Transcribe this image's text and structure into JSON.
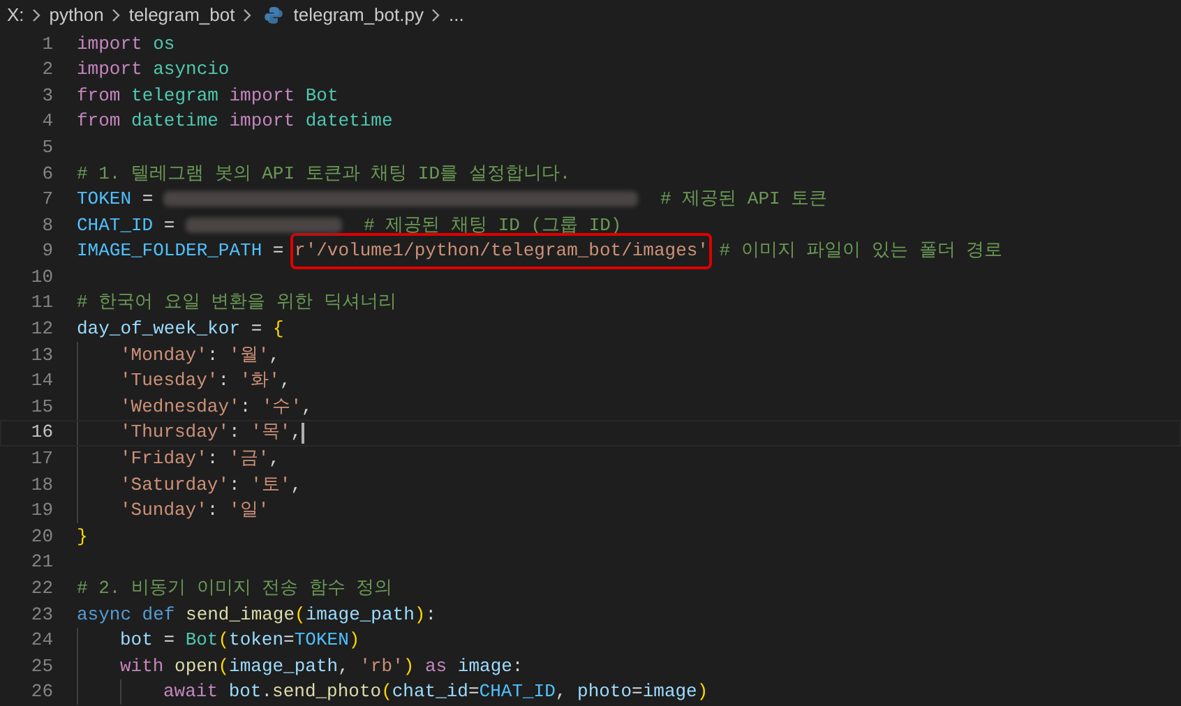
{
  "breadcrumb": [
    {
      "kind": "folder",
      "text": "X:"
    },
    {
      "kind": "folder",
      "text": "python"
    },
    {
      "kind": "folder",
      "text": "telegram_bot"
    },
    {
      "kind": "file",
      "text": "telegram_bot.py"
    },
    {
      "kind": "more",
      "text": "..."
    }
  ],
  "lines": [
    {
      "number": "1",
      "current": false,
      "tokens": [
        {
          "kind": "keyword",
          "text": "import"
        },
        {
          "kind": "type",
          "text": " os"
        }
      ]
    },
    {
      "number": "2",
      "current": false,
      "tokens": [
        {
          "kind": "keyword",
          "text": "import"
        },
        {
          "kind": "type",
          "text": " asyncio"
        }
      ]
    },
    {
      "number": "3",
      "current": false,
      "tokens": [
        {
          "kind": "keyword",
          "text": "from"
        },
        {
          "kind": "type",
          "text": " telegram"
        },
        {
          "kind": "keyword",
          "text": " import"
        },
        {
          "kind": "type",
          "text": " Bot"
        }
      ]
    },
    {
      "number": "4",
      "current": false,
      "tokens": [
        {
          "kind": "keyword",
          "text": "from"
        },
        {
          "kind": "type",
          "text": " datetime"
        },
        {
          "kind": "keyword",
          "text": " import"
        },
        {
          "kind": "type",
          "text": " datetime"
        }
      ]
    },
    {
      "number": "5",
      "current": false
    },
    {
      "number": "6",
      "current": false,
      "tokens": [
        {
          "kind": "comment",
          "text": "# 1. 텔레그램 봇의 API 토큰과 채팅 ID를 설정합니다."
        }
      ]
    },
    {
      "number": "7",
      "current": false,
      "tokens": [
        {
          "kind": "constant",
          "text": "TOKEN"
        },
        {
          "kind": "plain",
          "text": " = "
        },
        {
          "kind": "redacted"
        },
        {
          "kind": "comment",
          "text": "  # 제공된 API 토큰"
        }
      ]
    },
    {
      "number": "8",
      "current": false,
      "tokens": [
        {
          "kind": "constant",
          "text": "CHAT_ID"
        },
        {
          "kind": "plain",
          "text": " = "
        },
        {
          "kind": "redacted_short"
        },
        {
          "kind": "comment",
          "text": "  # 제공된 채팅 ID (그룹 ID)"
        }
      ]
    },
    {
      "number": "9",
      "current": false,
      "tokens": [
        {
          "kind": "constant",
          "text": "IMAGE_FOLDER_PATH"
        },
        {
          "kind": "plain",
          "text": " = "
        },
        {
          "kind": "string",
          "text": "r'/volume1/python/telegram_bot/images'",
          "highlighted": true
        },
        {
          "kind": "comment",
          "text": " # 이미지 파일이 있는 폴더 경로"
        }
      ]
    },
    {
      "number": "10",
      "current": false
    },
    {
      "number": "11",
      "current": false,
      "tokens": [
        {
          "kind": "comment",
          "text": "# 한국어 요일 변환을 위한 딕셔너리"
        }
      ]
    },
    {
      "number": "12",
      "current": false,
      "tokens": [
        {
          "kind": "variable",
          "text": "day_of_week_kor"
        },
        {
          "kind": "plain",
          "text": " = "
        },
        {
          "kind": "bracket",
          "text": "{"
        }
      ],
      "children": [
        {
          "number": "13",
          "current": false,
          "tokens": [
            {
              "kind": "string",
              "text": "'Monday'"
            },
            {
              "kind": "plain",
              "text": ": "
            },
            {
              "kind": "string",
              "text": "'월'"
            },
            {
              "kind": "plain",
              "text": ","
            }
          ]
        },
        {
          "number": "14",
          "current": false,
          "tokens": [
            {
              "kind": "string",
              "text": "'Tuesday'"
            },
            {
              "kind": "plain",
              "text": ": "
            },
            {
              "kind": "string",
              "text": "'화'"
            },
            {
              "kind": "plain",
              "text": ","
            }
          ]
        },
        {
          "number": "15",
          "current": false,
          "tokens": [
            {
              "kind": "string",
              "text": "'Wednesday'"
            },
            {
              "kind": "plain",
              "text": ": "
            },
            {
              "kind": "string",
              "text": "'수'"
            },
            {
              "kind": "plain",
              "text": ","
            }
          ]
        },
        {
          "number": "16",
          "current": true,
          "tokens": [
            {
              "kind": "string",
              "text": "'Thursday'"
            },
            {
              "kind": "plain",
              "text": ": "
            },
            {
              "kind": "string",
              "text": "'목'"
            },
            {
              "kind": "plain",
              "text": ","
            }
          ]
        },
        {
          "number": "17",
          "current": false,
          "tokens": [
            {
              "kind": "string",
              "text": "'Friday'"
            },
            {
              "kind": "plain",
              "text": ": "
            },
            {
              "kind": "string",
              "text": "'금'"
            },
            {
              "kind": "plain",
              "text": ","
            }
          ]
        },
        {
          "number": "18",
          "current": false,
          "tokens": [
            {
              "kind": "string",
              "text": "'Saturday'"
            },
            {
              "kind": "plain",
              "text": ": "
            },
            {
              "kind": "string",
              "text": "'토'"
            },
            {
              "kind": "plain",
              "text": ","
            }
          ]
        },
        {
          "number": "19",
          "current": false,
          "tokens": [
            {
              "kind": "string",
              "text": "'Sunday'"
            },
            {
              "kind": "plain",
              "text": ": "
            },
            {
              "kind": "string",
              "text": "'일'"
            }
          ]
        }
      ]
    },
    {
      "number": "20",
      "current": false,
      "tokens": [
        {
          "kind": "bracket",
          "text": "}"
        }
      ]
    },
    {
      "number": "21",
      "current": false
    },
    {
      "number": "22",
      "current": false,
      "tokens": [
        {
          "kind": "comment",
          "text": "# 2. 비동기 이미지 전송 함수 정의"
        }
      ]
    },
    {
      "number": "23",
      "current": false,
      "tokens": [
        {
          "kind": "storage",
          "text": "async def"
        },
        {
          "kind": "function",
          "text": " send_image"
        },
        {
          "kind": "bracket",
          "text": "("
        },
        {
          "kind": "variable",
          "text": "image_path"
        },
        {
          "kind": "bracket",
          "text": ")"
        },
        {
          "kind": "plain",
          "text": ":"
        }
      ],
      "children": [
        {
          "number": "24",
          "current": false,
          "tokens": [
            {
              "kind": "variable",
              "text": "bot"
            },
            {
              "kind": "plain",
              "text": " = "
            },
            {
              "kind": "type",
              "text": "Bot"
            },
            {
              "kind": "bracket",
              "text": "("
            },
            {
              "kind": "variable",
              "text": "token"
            },
            {
              "kind": "plain",
              "text": "="
            },
            {
              "kind": "constant",
              "text": "TOKEN"
            },
            {
              "kind": "bracket",
              "text": ")"
            }
          ]
        },
        {
          "number": "25",
          "current": false,
          "tokens": [
            {
              "kind": "keyword",
              "text": "with"
            },
            {
              "kind": "function",
              "text": " open"
            },
            {
              "kind": "bracket",
              "text": "("
            },
            {
              "kind": "variable",
              "text": "image_path"
            },
            {
              "kind": "plain",
              "text": ", "
            },
            {
              "kind": "string",
              "text": "'rb'"
            },
            {
              "kind": "bracket",
              "text": ")"
            },
            {
              "kind": "keyword",
              "text": " as"
            },
            {
              "kind": "variable",
              "text": " image"
            },
            {
              "kind": "plain",
              "text": ":"
            }
          ],
          "children": [
            {
              "number": "26",
              "current": false,
              "tokens": [
                {
                  "kind": "keyword",
                  "text": "await"
                },
                {
                  "kind": "variable",
                  "text": " bot"
                },
                {
                  "kind": "plain",
                  "text": "."
                },
                {
                  "kind": "function",
                  "text": "send_photo"
                },
                {
                  "kind": "bracket",
                  "text": "("
                },
                {
                  "kind": "variable",
                  "text": "chat_id"
                },
                {
                  "kind": "plain",
                  "text": "="
                },
                {
                  "kind": "constant",
                  "text": "CHAT_ID"
                },
                {
                  "kind": "plain",
                  "text": ", "
                },
                {
                  "kind": "variable",
                  "text": "photo"
                },
                {
                  "kind": "plain",
                  "text": "="
                },
                {
                  "kind": "variable",
                  "text": "image"
                },
                {
                  "kind": "bracket",
                  "text": ")"
                }
              ]
            }
          ]
        }
      ]
    }
  ]
}
